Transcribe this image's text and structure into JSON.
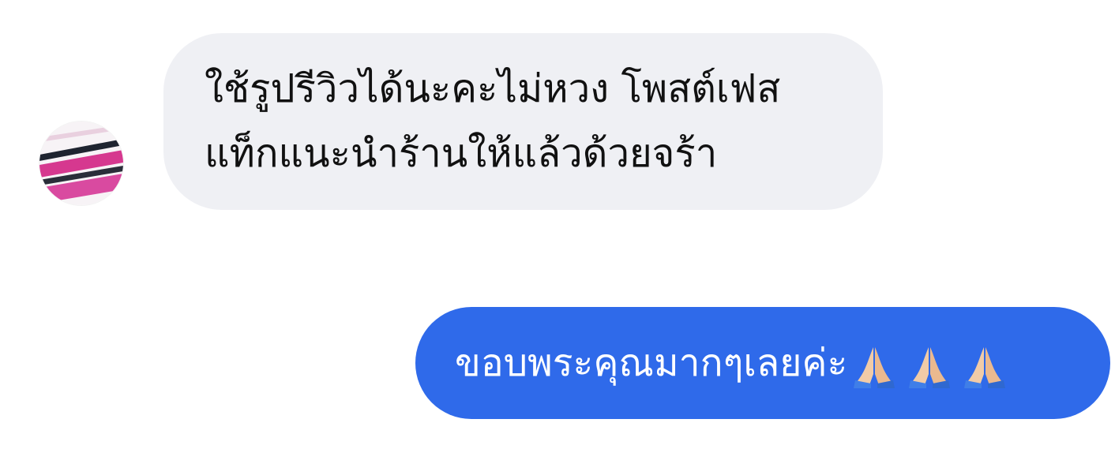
{
  "conversation": {
    "received": {
      "line1": "ใช้รูปรีวิวได้นะคะไม่หวง โพสต์เฟส",
      "line2": "แท็กแนะนำร้านให้แล้วด้วยจร้า"
    },
    "sent": {
      "text": "ขอบพระคุณมากๆเลยค่ะ",
      "emojis": [
        "praying-hands-icon",
        "praying-hands-icon",
        "praying-hands-icon"
      ]
    }
  },
  "colors": {
    "received_bubble": "#eff0f4",
    "sent_bubble": "#2f6aea",
    "sent_text": "#ffffff",
    "received_text": "#111111"
  }
}
